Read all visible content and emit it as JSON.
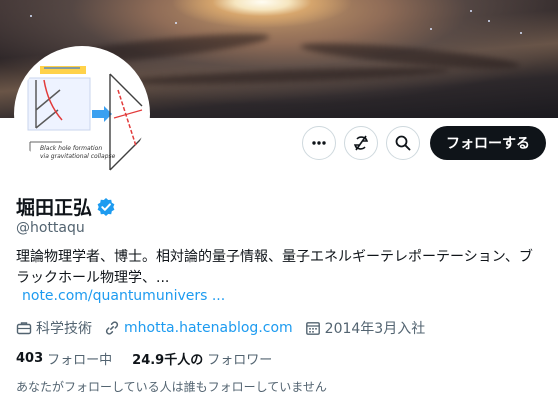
{
  "profile": {
    "display_name": "堀田正弘",
    "handle": "@hottaqu",
    "bio": "理論物理学者、博士。相対論的量子情報、量子エネルギーテレポーテーション、ブラックホール物理学、...",
    "bio_link": "note.com/quantumunivers ...",
    "category": "科学技術",
    "website": "mhotta.hatenablog.com",
    "joined": "2014年3月入社",
    "verified": true,
    "avatar_text_1": "Black hole formation",
    "avatar_text_2": "via gravitational collapse"
  },
  "stats": {
    "following_count": "403",
    "following_label": "フォロー中",
    "followers_count": "24.9千人の",
    "followers_label": "フォロワー"
  },
  "actions": {
    "follow_label": "フォローする",
    "more_icon": "more-horizontal-icon",
    "notify_icon": "subscribe-off-icon",
    "search_icon": "search-icon"
  },
  "mutual_note": "あなたがフォローしている人は誰もフォローしていません",
  "colors": {
    "link": "#1d9bf0",
    "verified": "#1d9bf0",
    "secondary_text": "#536471",
    "primary_text": "#0f1419",
    "follow_button": "#0f1419"
  }
}
